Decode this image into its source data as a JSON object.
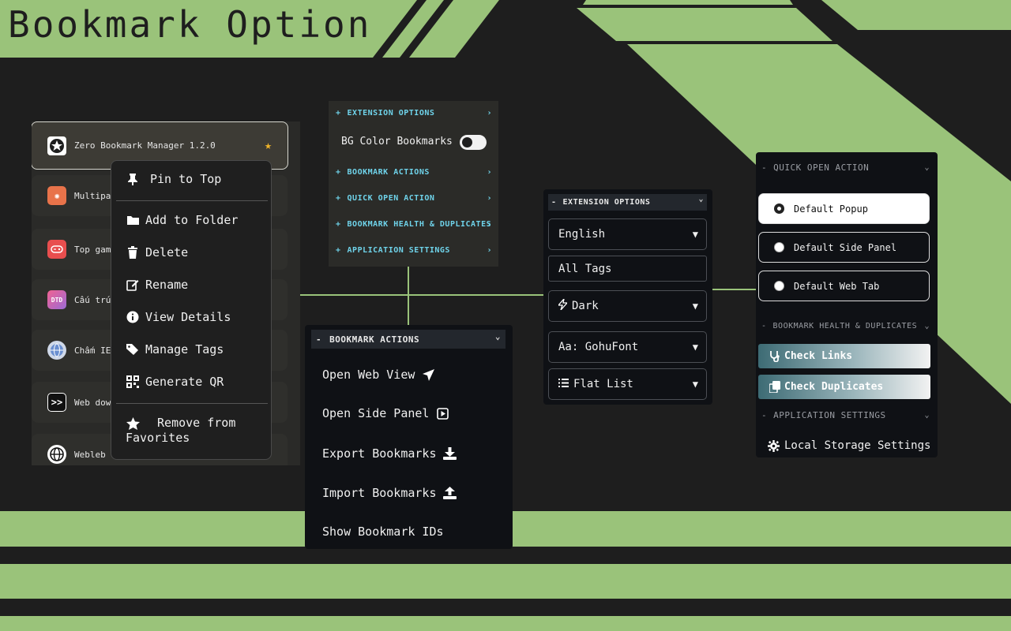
{
  "page": {
    "title": "Bookmark Option"
  },
  "bookmark_list": {
    "items": [
      {
        "title": "Zero Bookmark Manager 1.2.0",
        "icon": "star-circle-icon",
        "starred": true
      },
      {
        "title": "Multipa",
        "icon": "sunburst-icon"
      },
      {
        "title": "Top gam",
        "icon": "gamepad-icon"
      },
      {
        "title": "Cấu trú",
        "icon": "dtd-logo-icon",
        "badge": "DTD"
      },
      {
        "title": "Chấm IE",
        "icon": "globe-icon"
      },
      {
        "title": "Web dow",
        "icon": "double-chevron-icon",
        "badge": ">>"
      },
      {
        "title": "Webleb",
        "icon": "globe-outline-icon"
      }
    ]
  },
  "context_menu": {
    "pin": "Pin to Top",
    "add_folder": "Add to Folder",
    "delete": "Delete",
    "rename": "Rename",
    "view_details": "View Details",
    "manage_tags": "Manage Tags",
    "generate_qr": "Generate QR",
    "remove_fav": "Remove from Favorites"
  },
  "ext_options_top": {
    "extension_options": "EXTENSION OPTIONS",
    "bg_color": "BG Color Bookmarks",
    "bookmark_actions": "BOOKMARK ACTIONS",
    "quick_open": "QUICK OPEN ACTION",
    "health": "BOOKMARK HEALTH & DUPLICATES",
    "app_settings": "APPLICATION SETTINGS",
    "plus": "+",
    "chevron": "›"
  },
  "bookmark_actions": {
    "header": "BOOKMARK ACTIONS",
    "open_web_view": "Open Web View",
    "open_side_panel": "Open Side Panel",
    "export": "Export Bookmarks",
    "import": "Import Bookmarks",
    "show_ids": "Show Bookmark IDs",
    "dash": "-",
    "chevron": "⌄"
  },
  "ext_options_mid": {
    "header": "EXTENSION OPTIONS",
    "language": "English",
    "tags": "All Tags",
    "theme": "Dark",
    "font": "Aa: GohuFont",
    "view": "Flat List",
    "arrow": "▼"
  },
  "quick_open": {
    "header": "QUICK OPEN ACTION",
    "default_popup": "Default Popup",
    "default_side_panel": "Default Side Panel",
    "default_web_tab": "Default Web Tab",
    "health_header": "BOOKMARK HEALTH & DUPLICATES",
    "check_links": "Check Links",
    "check_duplicates": "Check Duplicates",
    "app_header": "APPLICATION SETTINGS",
    "local_storage": "Local Storage Settings",
    "dash": "-",
    "chevron": "⌄"
  },
  "colors": {
    "accent_green": "#9ac37a",
    "background": "#1e1e1e",
    "panel": "#0f1115",
    "link_blue": "#6fd3ea",
    "star": "#f0b429"
  }
}
